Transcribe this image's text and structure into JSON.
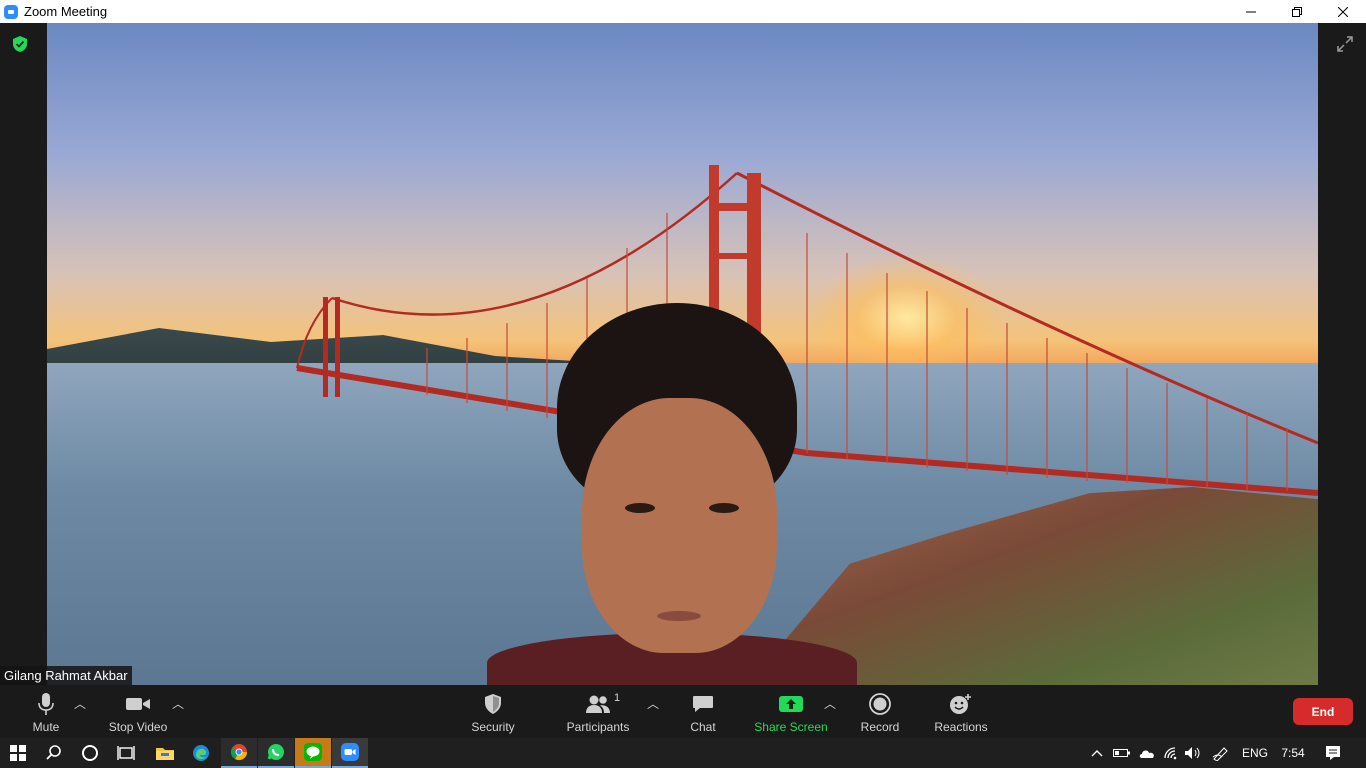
{
  "window": {
    "title": "Zoom Meeting",
    "app_icon": "zoom-icon"
  },
  "window_controls": {
    "minimize": "—",
    "restore": "❐",
    "close": "✕"
  },
  "video": {
    "participant_name": "Gilang Rahmat Akbar",
    "background": "golden-gate-bridge-sunset"
  },
  "toolbar": {
    "mute_label": "Mute",
    "stop_video_label": "Stop Video",
    "security_label": "Security",
    "participants_label": "Participants",
    "participants_count": "1",
    "chat_label": "Chat",
    "share_screen_label": "Share Screen",
    "record_label": "Record",
    "reactions_label": "Reactions",
    "end_label": "End",
    "share_color": "#23d959",
    "end_color": "#d52b2a"
  },
  "taskbar": {
    "apps": [
      "windows-start",
      "search",
      "cortana",
      "task-view",
      "file-explorer",
      "edge",
      "chrome",
      "whatsapp",
      "line",
      "zoom"
    ],
    "language": "ENG",
    "time": "7:54"
  }
}
